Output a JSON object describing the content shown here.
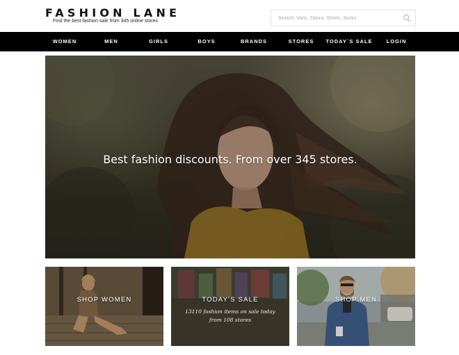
{
  "header": {
    "logo": "FASHION LANE",
    "tagline": "Find the best fashion sale from 345 online stores",
    "search_placeholder": "Search: Vans, Zalora, Shorts, Socks"
  },
  "nav": {
    "items": [
      {
        "label": "WOMEN"
      },
      {
        "label": "MEN"
      },
      {
        "label": "GIRLS"
      },
      {
        "label": "BOYS"
      },
      {
        "label": "BRANDS"
      },
      {
        "label": "STORES"
      },
      {
        "label": "TODAY`S SALE"
      },
      {
        "label": "LOGIN"
      }
    ]
  },
  "hero": {
    "headline": "Best fashion discounts. From over 345 stores."
  },
  "tiles": {
    "women": {
      "title": "SHOP WOMEN"
    },
    "sale": {
      "title": "TODAY'S SALE",
      "line1": "13110 fashion items on sale today",
      "line2": "from 108 stores"
    },
    "men": {
      "title": "SHOP MEN"
    }
  },
  "colors": {
    "nav_background": "#000000",
    "page_background": "#ffffff"
  }
}
